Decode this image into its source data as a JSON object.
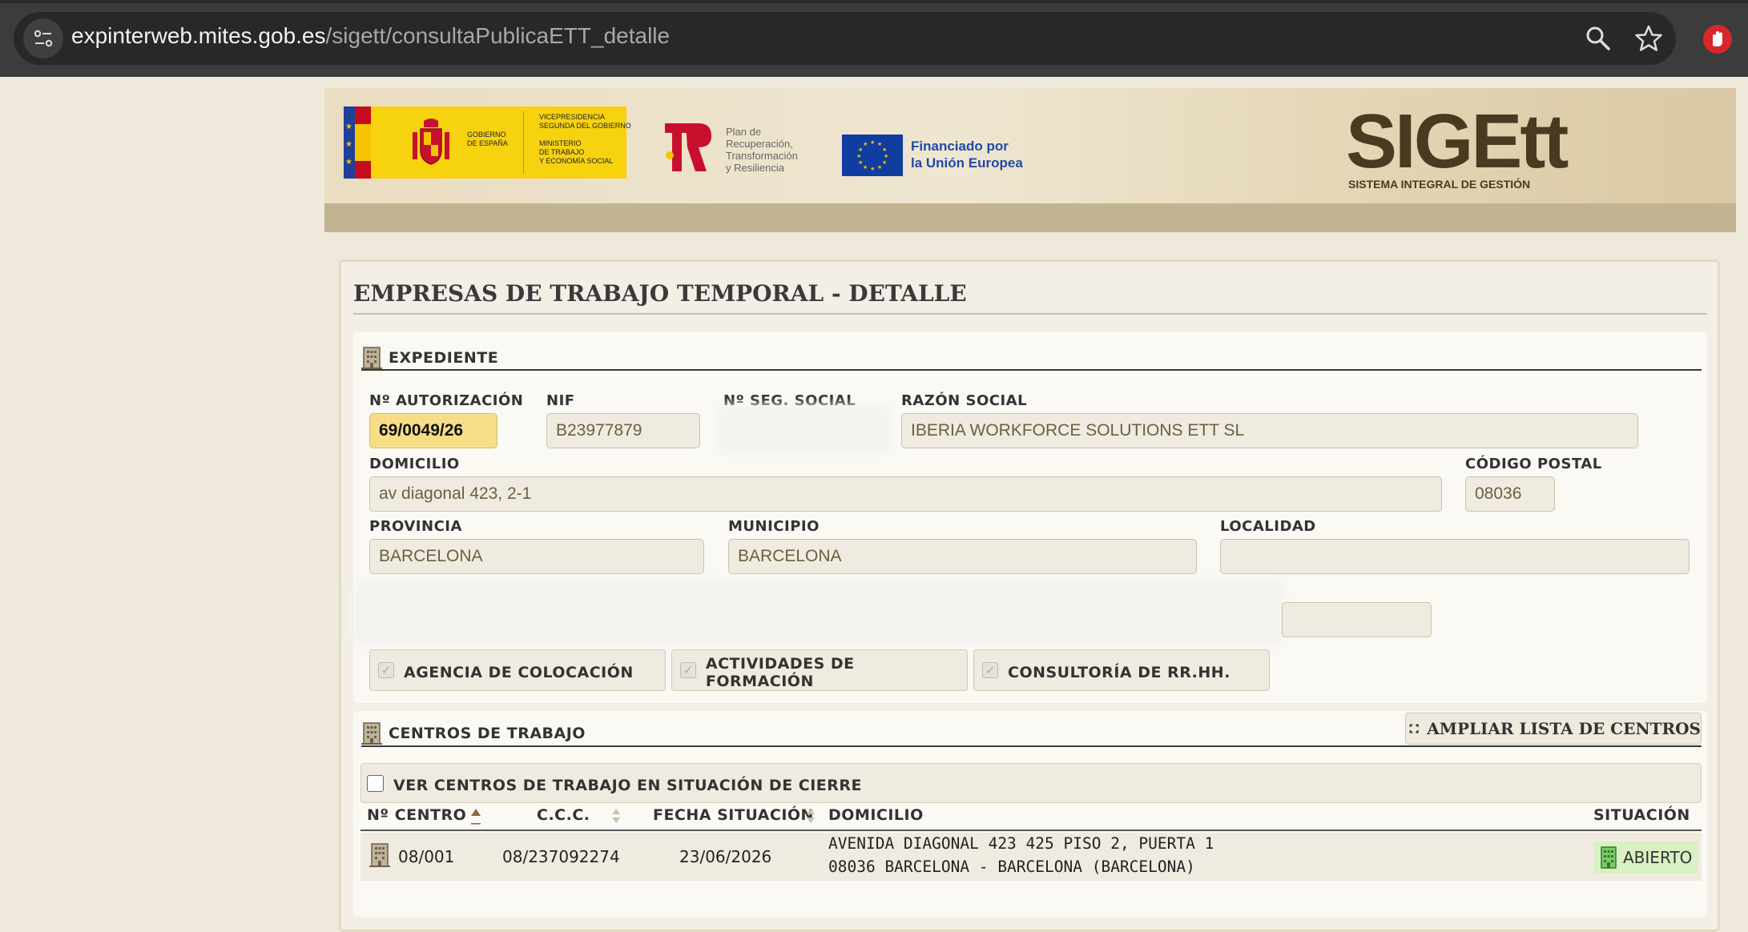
{
  "browser": {
    "url_host": "expinterweb.mites.gob.es",
    "url_path": "/sigett/consultaPublicaETT_detalle",
    "icons": [
      "site-settings-icon",
      "zoom-icon",
      "bookmark-star-icon",
      "extension-hand-icon"
    ]
  },
  "banner": {
    "gob_label": "GOBIERNO\nDE ESPAÑA",
    "gob_ministry": "VICEPRESIDENCIA\nSEGUNDA DEL GOBIERNO\n\nMINISTERIO\nDE TRABAJO\nY ECONOMÍA SOCIAL",
    "prtr_label": "Plan de\nRecuperación,\nTransformación\ny Resiliencia",
    "eu_label": "Financiado por\nla Unión Europea",
    "sigett_logo": "SIGEtt",
    "sigett_subtitle": "SISTEMA INTEGRAL DE GESTIÓN"
  },
  "page": {
    "title": "EMPRESAS DE TRABAJO TEMPORAL - DETALLE"
  },
  "expediente": {
    "section_title": "EXPEDIENTE",
    "labels": {
      "autorizacion": "Nº AUTORIZACIÓN",
      "nif": "NIF",
      "seg_social": "Nº SEG. SOCIAL",
      "razon_social": "RAZÓN SOCIAL",
      "domicilio": "DOMICILIO",
      "codigo_postal": "CÓDIGO POSTAL",
      "provincia": "PROVINCIA",
      "municipio": "MUNICIPIO",
      "localidad": "LOCALIDAD"
    },
    "values": {
      "autorizacion": "69/0049/26",
      "nif": "B23977879",
      "razon_social": "IBERIA WORKFORCE SOLUTIONS ETT SL",
      "domicilio": "av diagonal 423, 2-1",
      "codigo_postal": "08036",
      "provincia": "BARCELONA",
      "municipio": "BARCELONA",
      "localidad": ""
    },
    "checkboxes": [
      {
        "label": "AGENCIA DE COLOCACIÓN",
        "checked": true
      },
      {
        "label": "ACTIVIDADES DE FORMACIÓN",
        "checked": true
      },
      {
        "label": "CONSULTORÍA DE RR.HH.",
        "checked": true
      }
    ]
  },
  "centros": {
    "section_title": "CENTROS DE TRABAJO",
    "ampliar_label": "AMPLIAR LISTA DE CENTROS",
    "filter_label": "VER CENTROS DE TRABAJO EN SITUACIÓN DE CIERRE",
    "filter_checked": false,
    "columns": [
      "Nº CENTRO",
      "C.C.C.",
      "FECHA SITUACIÓN",
      "DOMICILIO",
      "SITUACIÓN"
    ],
    "rows": [
      {
        "centro": "08/001",
        "ccc": "08/237092274",
        "fecha": "23/06/2026",
        "domicilio_1": "AVENIDA DIAGONAL 423 425 PISO 2, PUERTA 1",
        "domicilio_2": "08036 BARCELONA - BARCELONA (BARCELONA)",
        "situacion": "ABIERTO"
      }
    ]
  },
  "colors": {
    "page_bg": "#efe9db",
    "highlight_field": "#f7dd86",
    "status_open_bg": "#d9f0c2",
    "brand_brown": "#4a3a22"
  }
}
